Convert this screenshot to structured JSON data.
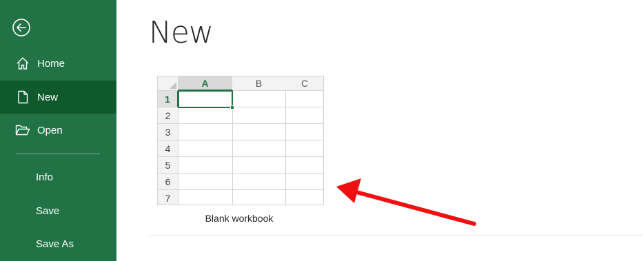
{
  "sidebar": {
    "background": "#217346",
    "active_background": "#0f5a2d",
    "back_icon": "back-arrow-icon",
    "items": [
      {
        "label": "Home",
        "icon": "home-icon"
      },
      {
        "label": "New",
        "icon": "new-document-icon",
        "active": true
      },
      {
        "label": "Open",
        "icon": "folder-open-icon"
      },
      {
        "label": "Info"
      },
      {
        "label": "Save"
      },
      {
        "label": "Save As"
      }
    ]
  },
  "main": {
    "title": "New",
    "templates": [
      {
        "caption": "Blank workbook",
        "columns": [
          "A",
          "B",
          "C"
        ],
        "rows": [
          "1",
          "2",
          "3",
          "4",
          "5",
          "6",
          "7"
        ],
        "selected_cell": "A1"
      }
    ]
  },
  "annotation": {
    "type": "red-arrow",
    "color": "#ee1111",
    "points_to": "Blank workbook"
  }
}
